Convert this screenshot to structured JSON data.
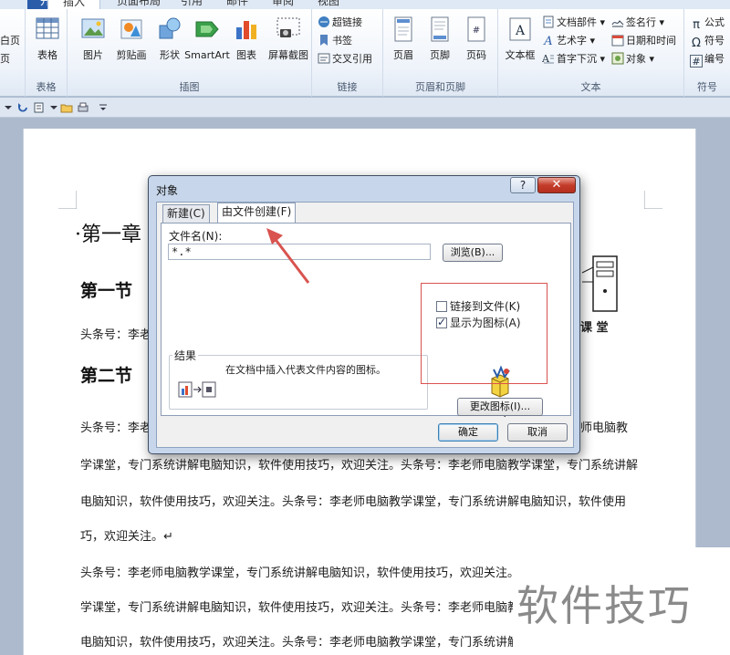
{
  "ribbon": {
    "tabs": [
      "开始",
      "插入",
      "页面布局",
      "引用",
      "邮件",
      "审阅",
      "视图"
    ],
    "active_tab": "插入",
    "groups": {
      "pages_partial": [
        "白页",
        "页"
      ],
      "table": {
        "label": "表格",
        "button": "表格"
      },
      "illustrations": {
        "label": "插图",
        "buttons": [
          "图片",
          "剪贴画",
          "形状",
          "SmartArt",
          "图表",
          "屏幕截图"
        ]
      },
      "links": {
        "label": "链接",
        "buttons": [
          "超链接",
          "书签",
          "交叉引用"
        ]
      },
      "header_footer": {
        "label": "页眉和页脚",
        "buttons": [
          "页眉",
          "页脚",
          "页码"
        ]
      },
      "text": {
        "label": "文本",
        "big": "文本框",
        "col1": [
          "文档部件",
          "艺术字",
          "首字下沉"
        ],
        "col2": [
          "签名行",
          "日期和时间",
          "对象"
        ]
      },
      "symbols": {
        "label": "符号",
        "buttons": [
          "公式",
          "符号",
          "编号"
        ]
      }
    }
  },
  "document": {
    "heading1": "第一章",
    "heading2_a": "第一节",
    "heading2_b": "第二节",
    "body_short": "头条号：李老",
    "body_lines": [
      "头条号：李老",
      "学课堂，专门系统讲解电脑知识，软件使用技巧，欢迎关注。头条号：李老师电脑教学课堂，专门系统讲解",
      "电脑知识，软件使用技巧，欢迎关注。头条号：李老师电脑教学课堂，专门系统讲解电脑知识，软件使用",
      "巧，欢迎关注。↵",
      "头条号：李老师电脑教学课堂，专门系统讲解电脑知识，软件使用技巧，欢迎关注。",
      "学课堂，专门系统讲解电脑知识，软件使用技巧，欢迎关注。头条号：李老师电脑教",
      "电脑知识，软件使用技巧，欢迎关注。头条号：李老师电脑教学课堂，专门系统讲解"
    ],
    "right_fragment_1": "师电脑教",
    "right_logo_text": "课 堂"
  },
  "watermark": "软件技巧",
  "dialog": {
    "title": "对象",
    "help": "?",
    "close": "✕",
    "tabs": [
      "新建(C)",
      "由文件创建(F)"
    ],
    "active_tab": "由文件创建(F)",
    "filename_label": "文件名(N):",
    "filename_value": "*.*",
    "browse_button": "浏览(B)...",
    "link_to_file": {
      "label": "链接到文件(K)",
      "checked": false
    },
    "display_as_icon": {
      "label": "显示为图标(A)",
      "checked": true
    },
    "result_label": "结果",
    "result_text": "在文档中插入代表文件内容的图标。",
    "icon_caption": "*.*",
    "change_icon_button": "更改图标(I)...",
    "ok_button": "确定",
    "cancel_button": "取消"
  },
  "colors": {
    "file_tab": "#2a5caa",
    "annotation": "#d9534f",
    "dialog_frame": "#c7d6ea"
  }
}
